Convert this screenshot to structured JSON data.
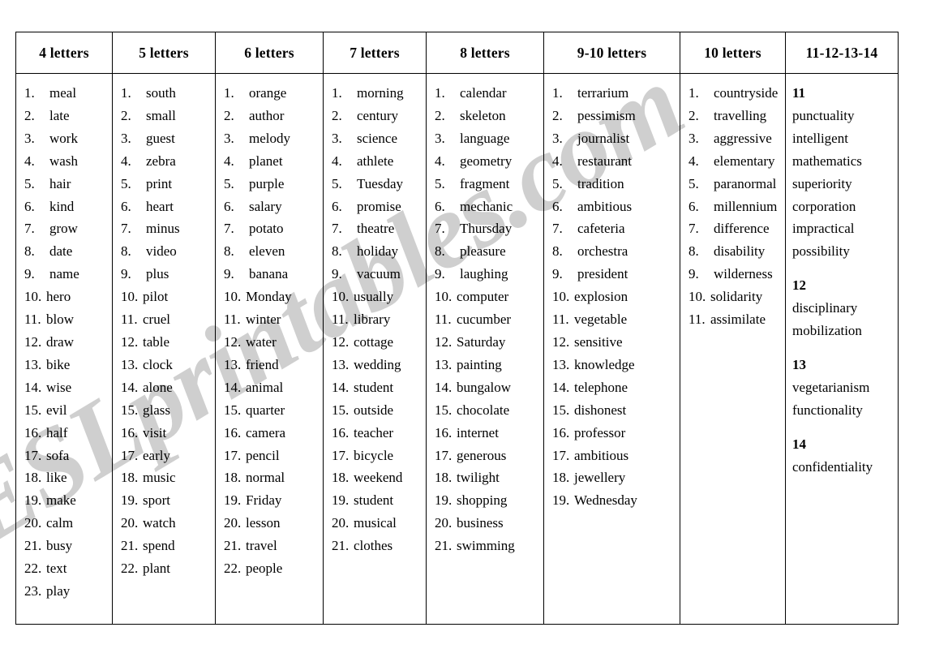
{
  "watermark": {
    "text": "ESLprintables.com",
    "color": "#cfcfcf"
  },
  "table": {
    "columns": [
      {
        "header": "4 letters",
        "type": "numbered",
        "words": [
          "meal",
          "late",
          "work",
          "wash",
          "hair",
          "kind",
          "grow",
          "date",
          "name",
          "hero",
          "blow",
          "draw",
          "bike",
          "wise",
          "evil",
          "half",
          "sofa",
          "like",
          "make",
          "calm",
          "busy",
          "text",
          "play"
        ]
      },
      {
        "header": "5 letters",
        "type": "numbered",
        "words": [
          "south",
          "small",
          "guest",
          "zebra",
          "print",
          "heart",
          "minus",
          "video",
          "plus",
          "pilot",
          "cruel",
          "table",
          "clock",
          "alone",
          "glass",
          "visit",
          "early",
          "music",
          "sport",
          "watch",
          "spend",
          "plant"
        ]
      },
      {
        "header": "6 letters",
        "type": "numbered",
        "words": [
          "orange",
          "author",
          "melody",
          "planet",
          "purple",
          "salary",
          "potato",
          "eleven",
          "banana",
          "Monday",
          "winter",
          "water",
          "friend",
          "animal",
          "quarter",
          "camera",
          "pencil",
          "normal",
          "Friday",
          "lesson",
          "travel",
          "people"
        ]
      },
      {
        "header": "7 letters",
        "type": "numbered",
        "words": [
          "morning",
          "century",
          "science",
          "athlete",
          "Tuesday",
          "promise",
          "theatre",
          "holiday",
          "vacuum",
          "usually",
          "library",
          "cottage",
          "wedding",
          "student",
          "outside",
          "teacher",
          "bicycle",
          "weekend",
          "student",
          "musical",
          "clothes"
        ]
      },
      {
        "header": "8 letters",
        "type": "numbered",
        "words": [
          "calendar",
          "skeleton",
          "language",
          "geometry",
          "fragment",
          "mechanic",
          "Thursday",
          "pleasure",
          "laughing",
          "computer",
          "cucumber",
          "Saturday",
          "painting",
          "bungalow",
          "chocolate",
          "internet",
          "generous",
          "twilight",
          "shopping",
          "business",
          "swimming"
        ]
      },
      {
        "header": "9-10 letters",
        "type": "numbered",
        "words": [
          "terrarium",
          "pessimism",
          "journalist",
          "restaurant",
          "tradition",
          "ambitious",
          "cafeteria",
          "orchestra",
          "president",
          "explosion",
          "vegetable",
          "sensitive",
          "knowledge",
          "telephone",
          "dishonest",
          "professor",
          "ambitious",
          "jewellery",
          "Wednesday"
        ]
      },
      {
        "header": "10 letters",
        "type": "numbered",
        "words": [
          "countryside",
          "travelling",
          "aggressive",
          "elementary",
          "paranormal",
          "millennium",
          "difference",
          "disability",
          "wilderness",
          "solidarity",
          "assimilate"
        ]
      },
      {
        "header": "11-12-13-14",
        "type": "grouped",
        "groups": [
          {
            "label": "11",
            "words": [
              "punctuality",
              "intelligent",
              "mathematics",
              "superiority",
              "corporation",
              "impractical",
              "possibility"
            ]
          },
          {
            "label": "12",
            "words": [
              "disciplinary",
              "mobilization"
            ]
          },
          {
            "label": "13",
            "words": [
              "vegetarianism",
              "functionality"
            ]
          },
          {
            "label": "14",
            "words": [
              "confidentiality"
            ]
          }
        ]
      }
    ]
  }
}
